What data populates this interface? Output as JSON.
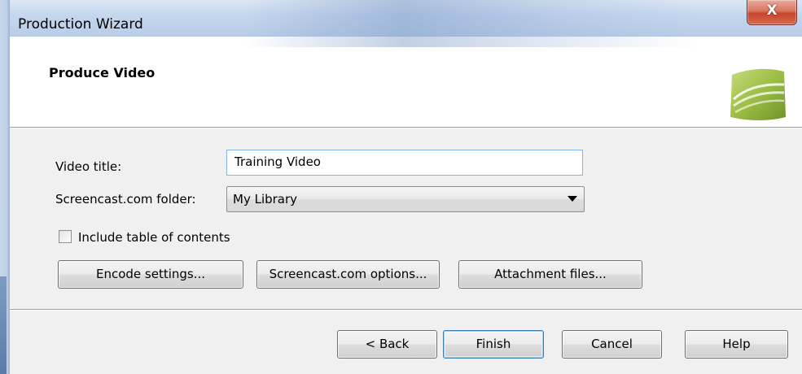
{
  "window": {
    "title": "Production Wizard",
    "close_label": "X"
  },
  "header": {
    "title": "Produce Video"
  },
  "form": {
    "video_title_label": "Video title:",
    "video_title_value": "Training Video",
    "folder_label": "Screencast.com folder:",
    "folder_value": "My Library",
    "toc_label": "Include table of contents",
    "toc_checked": false
  },
  "option_buttons": {
    "encode": "Encode settings...",
    "screencast": "Screencast.com options...",
    "attachments": "Attachment files..."
  },
  "nav_buttons": {
    "back": "< Back",
    "finish": "Finish",
    "cancel": "Cancel",
    "help": "Help"
  },
  "colors": {
    "logo_green": "#8fb43c",
    "close_red": "#c7452c",
    "input_border": "#7eb4ea"
  }
}
